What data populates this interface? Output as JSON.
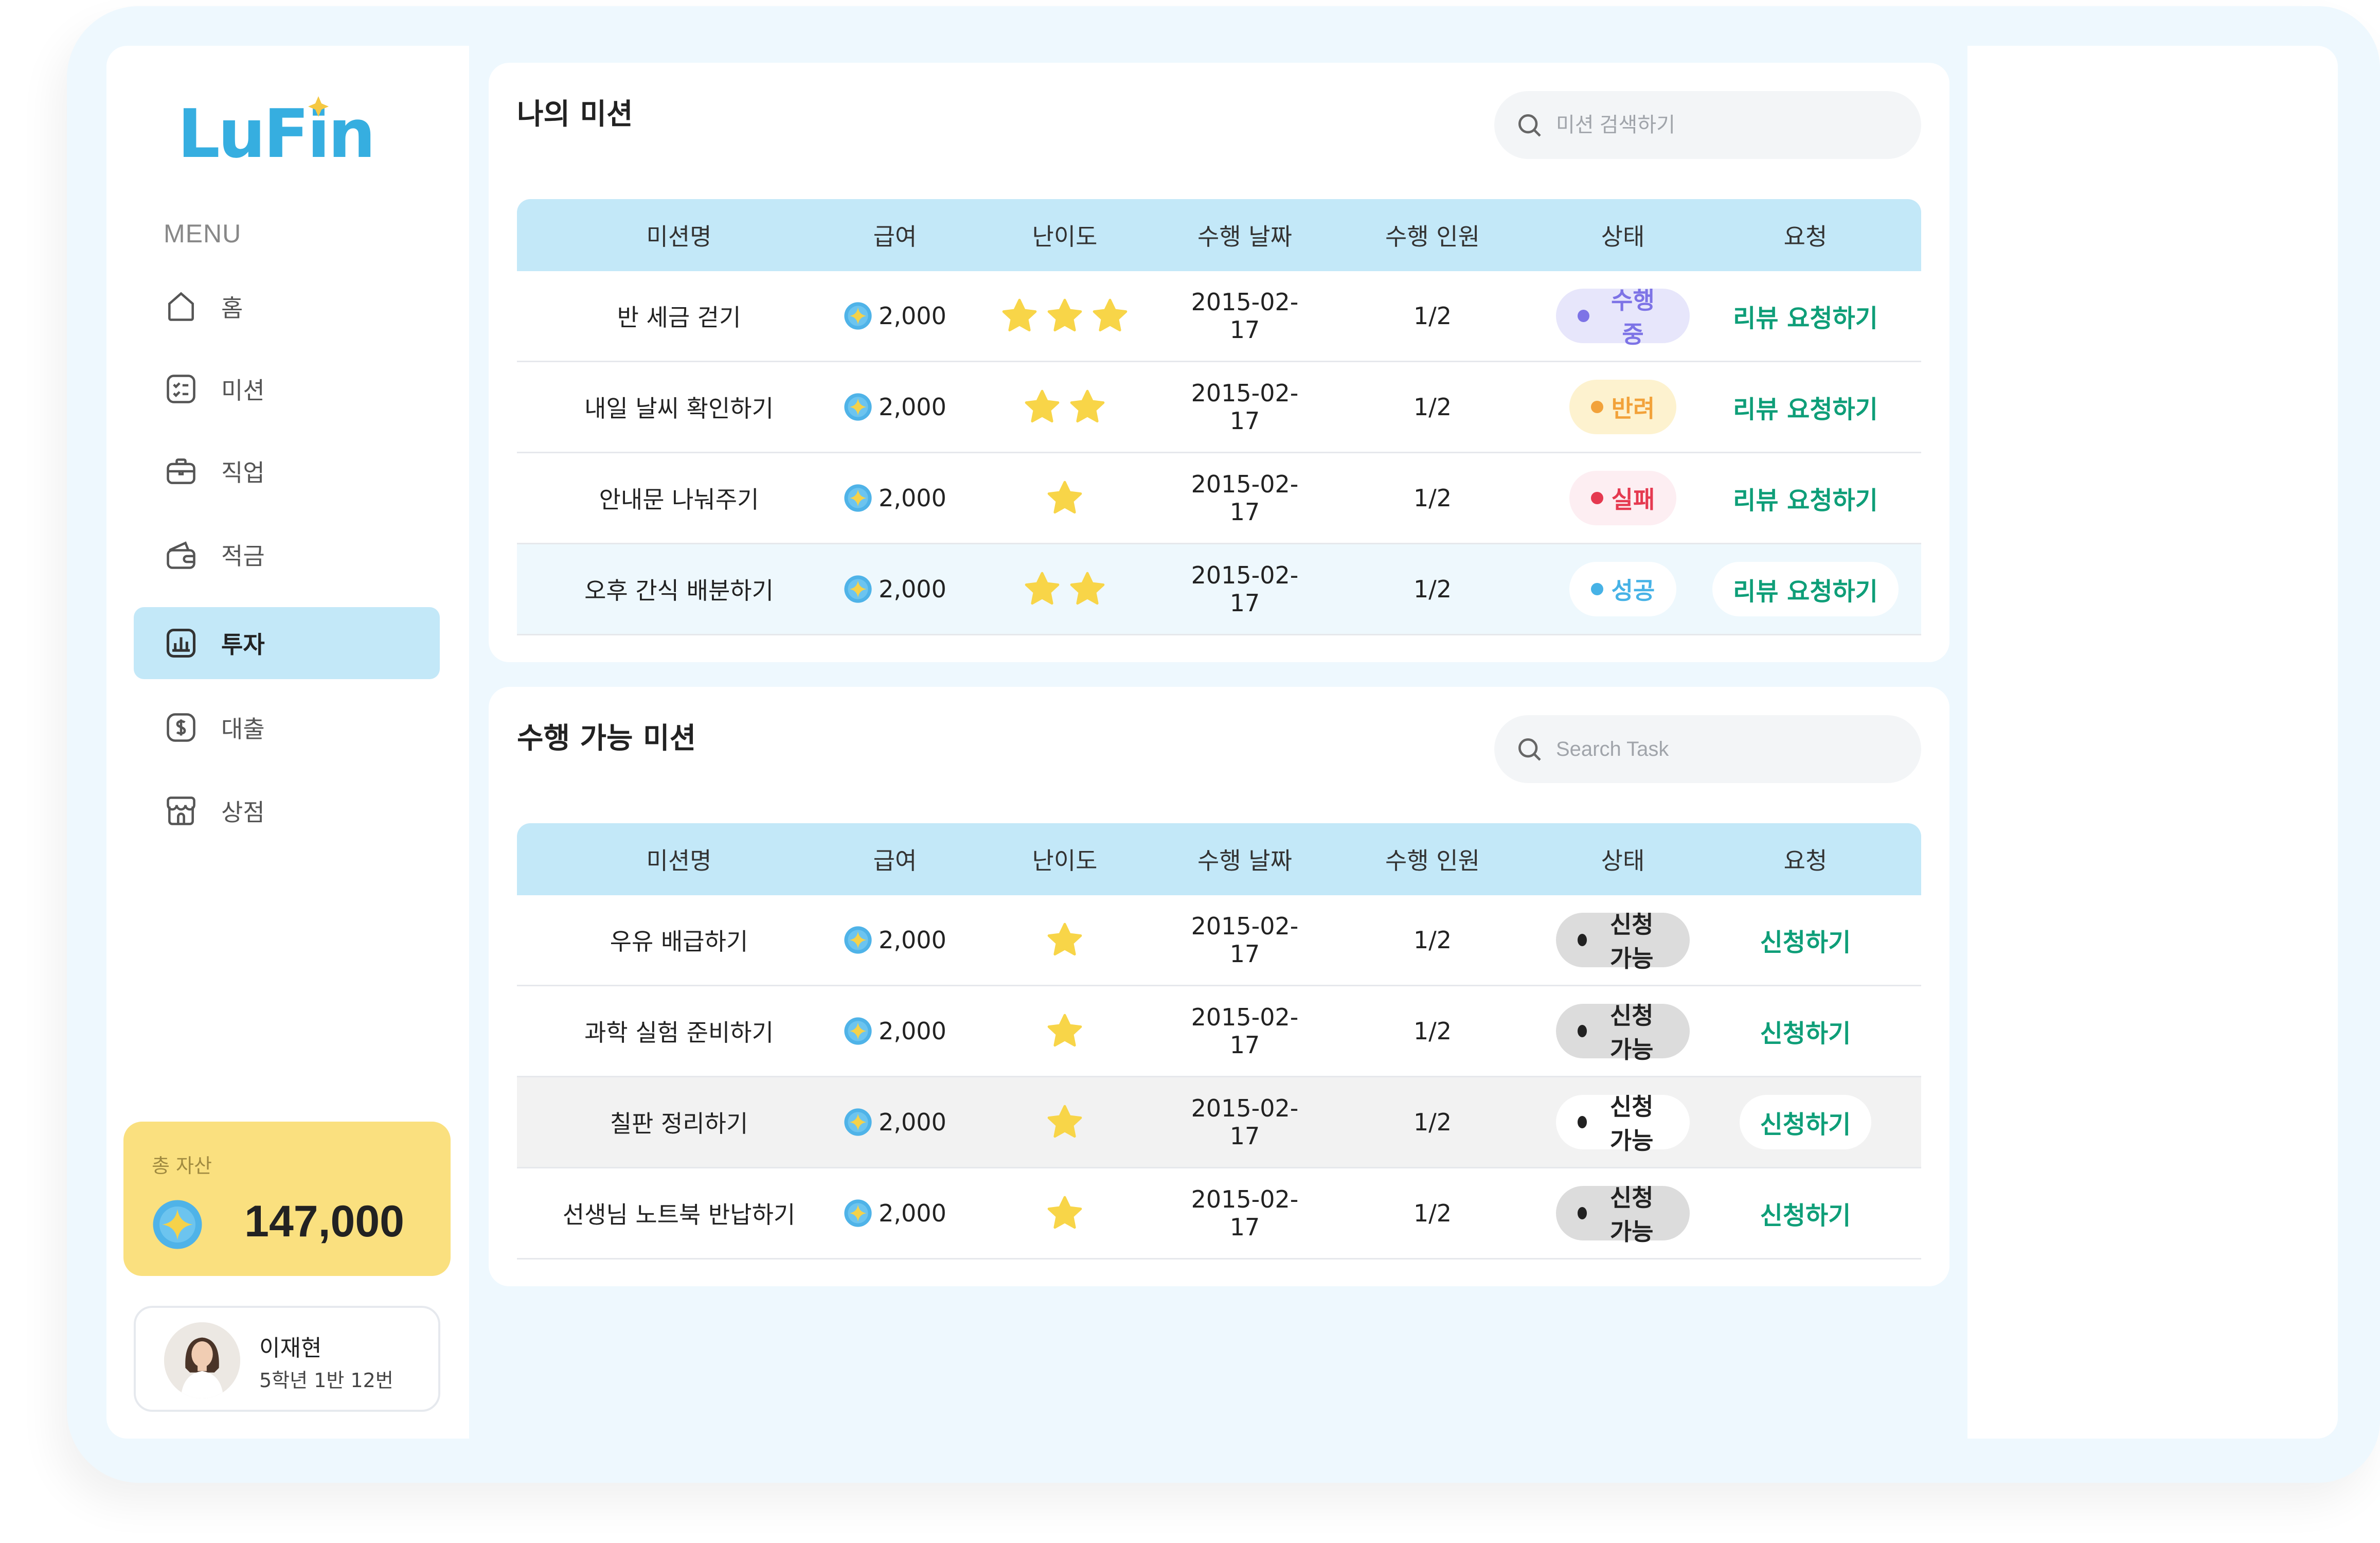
{
  "app": {
    "logo_text": "LuFin"
  },
  "sidebar": {
    "menu_title": "MENU",
    "items": [
      {
        "label": "홈",
        "icon": "home-icon"
      },
      {
        "label": "미션",
        "icon": "checklist-icon"
      },
      {
        "label": "직업",
        "icon": "briefcase-icon"
      },
      {
        "label": "적금",
        "icon": "wallet-icon"
      },
      {
        "label": "투자",
        "icon": "chart-icon",
        "active": true
      },
      {
        "label": "대출",
        "icon": "dollar-icon"
      },
      {
        "label": "상점",
        "icon": "store-icon"
      }
    ],
    "asset": {
      "label": "총 자산",
      "value": "147,000"
    },
    "profile": {
      "name": "이재현",
      "class_info": "5학년 1반 12번"
    }
  },
  "my_missions": {
    "title": "나의 미션",
    "search_placeholder": "미션 검색하기",
    "headers": [
      "미션명",
      "급여",
      "난이도",
      "수행 날짜",
      "수행 인원",
      "상태",
      "요청"
    ],
    "rows": [
      {
        "name": "반 세금 걷기",
        "pay": "2,000",
        "stars": 3,
        "date": "2015-02-17",
        "people": "1/2",
        "status": "수행 중",
        "action": "리뷰 요청하기"
      },
      {
        "name": "내일 날씨 확인하기",
        "pay": "2,000",
        "stars": 2,
        "date": "2015-02-17",
        "people": "1/2",
        "status": "반려",
        "action": "리뷰 요청하기"
      },
      {
        "name": "안내문 나눠주기",
        "pay": "2,000",
        "stars": 1,
        "date": "2015-02-17",
        "people": "1/2",
        "status": "실패",
        "action": "리뷰 요청하기"
      },
      {
        "name": "오후 간식 배분하기",
        "pay": "2,000",
        "stars": 2,
        "date": "2015-02-17",
        "people": "1/2",
        "status": "성공",
        "action": "리뷰 요청하기"
      }
    ]
  },
  "available_missions": {
    "title": "수행 가능 미션",
    "search_placeholder": "Search Task",
    "headers": [
      "미션명",
      "급여",
      "난이도",
      "수행 날짜",
      "수행 인원",
      "상태",
      "요청"
    ],
    "rows": [
      {
        "name": "우유 배급하기",
        "pay": "2,000",
        "stars": 1,
        "date": "2015-02-17",
        "people": "1/2",
        "status": "신청 가능",
        "action": "신청하기"
      },
      {
        "name": "과학 실험 준비하기",
        "pay": "2,000",
        "stars": 1,
        "date": "2015-02-17",
        "people": "1/2",
        "status": "신청 가능",
        "action": "신청하기"
      },
      {
        "name": "칠판 정리하기",
        "pay": "2,000",
        "stars": 1,
        "date": "2015-02-17",
        "people": "1/2",
        "status": "신청 가능",
        "action": "신청하기"
      },
      {
        "name": "선생님 노트북 반납하기",
        "pay": "2,000",
        "stars": 1,
        "date": "2015-02-17",
        "people": "1/2",
        "status": "신청 가능",
        "action": "신청하기"
      }
    ]
  },
  "colors": {
    "accent_blue": "#c3e8f8",
    "action_green": "#0e9e78",
    "asset_yellow": "#fae07f",
    "star_yellow": "#f8d548"
  }
}
